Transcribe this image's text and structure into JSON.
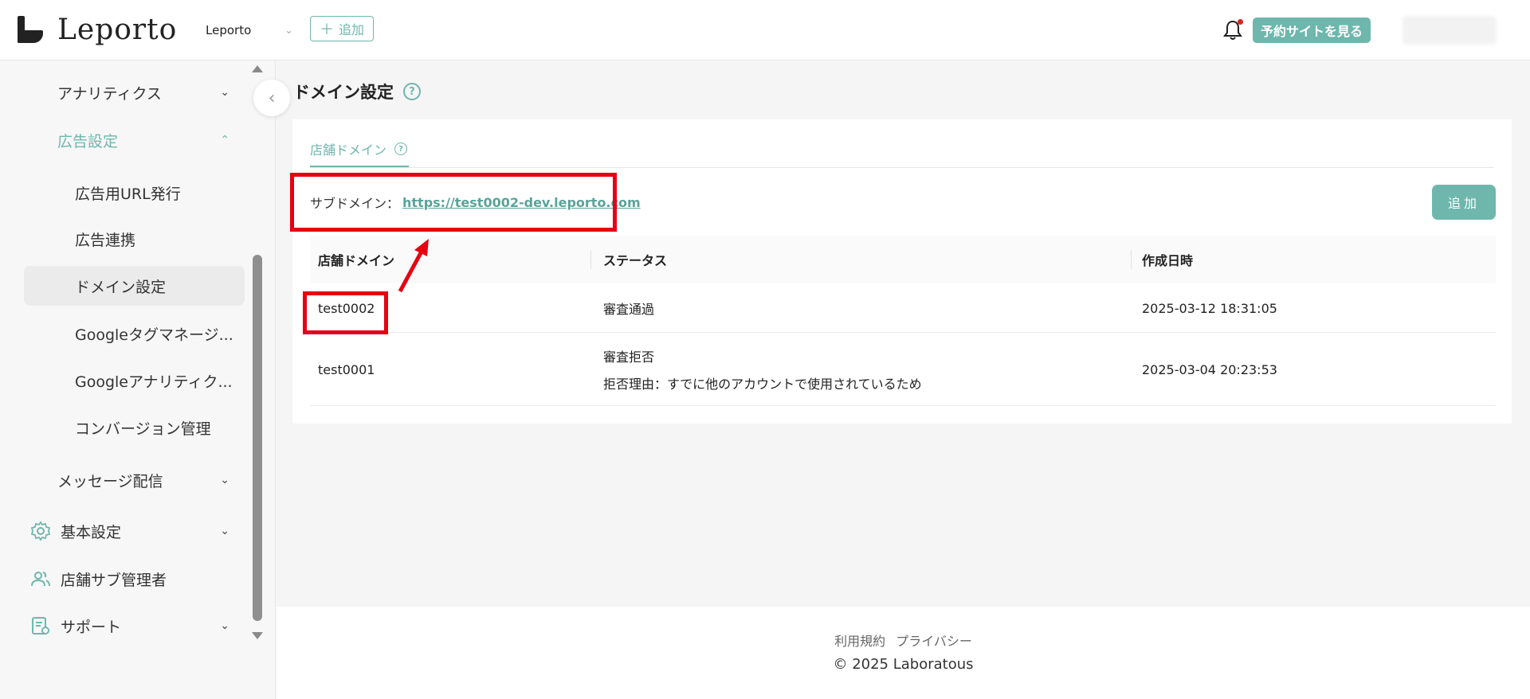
{
  "header": {
    "logo_text": "Leporto",
    "store_name": "Leporto",
    "add_label": "追加",
    "reserve_site_label": "予約サイトを見る"
  },
  "sidebar": {
    "items": [
      {
        "label": "アナリティクス"
      },
      {
        "label": "広告設定"
      },
      {
        "label": "広告用URL発行"
      },
      {
        "label": "広告連携"
      },
      {
        "label": "ドメイン設定"
      },
      {
        "label": "Googleタグマネージ..."
      },
      {
        "label": "Googleアナリティク..."
      },
      {
        "label": "コンバージョン管理"
      },
      {
        "label": "メッセージ配信"
      },
      {
        "label": "基本設定"
      },
      {
        "label": "店舗サブ管理者"
      },
      {
        "label": "サポート"
      }
    ]
  },
  "page": {
    "title": "ドメイン設定",
    "tab_label": "店舗ドメイン",
    "subdomain_label": "サブドメイン：",
    "subdomain_url": "https://test0002-dev.leporto.com",
    "add_button": "追加"
  },
  "table": {
    "headers": [
      "店舗ドメイン",
      "ステータス",
      "作成日時"
    ],
    "rows": [
      {
        "domain": "test0002",
        "status": "審査通過",
        "reason": "",
        "created": "2025-03-12 18:31:05"
      },
      {
        "domain": "test0001",
        "status": "審査拒否",
        "reason": "拒否理由：すでに他のアカウントで使用されているため",
        "created": "2025-03-04 20:23:53"
      }
    ]
  },
  "footer": {
    "terms": "利用規約",
    "privacy": "プライバシー",
    "copyright": "© 2025 Laboratous"
  },
  "colors": {
    "accent": "#6fb7ad",
    "highlight": "#e60012"
  }
}
